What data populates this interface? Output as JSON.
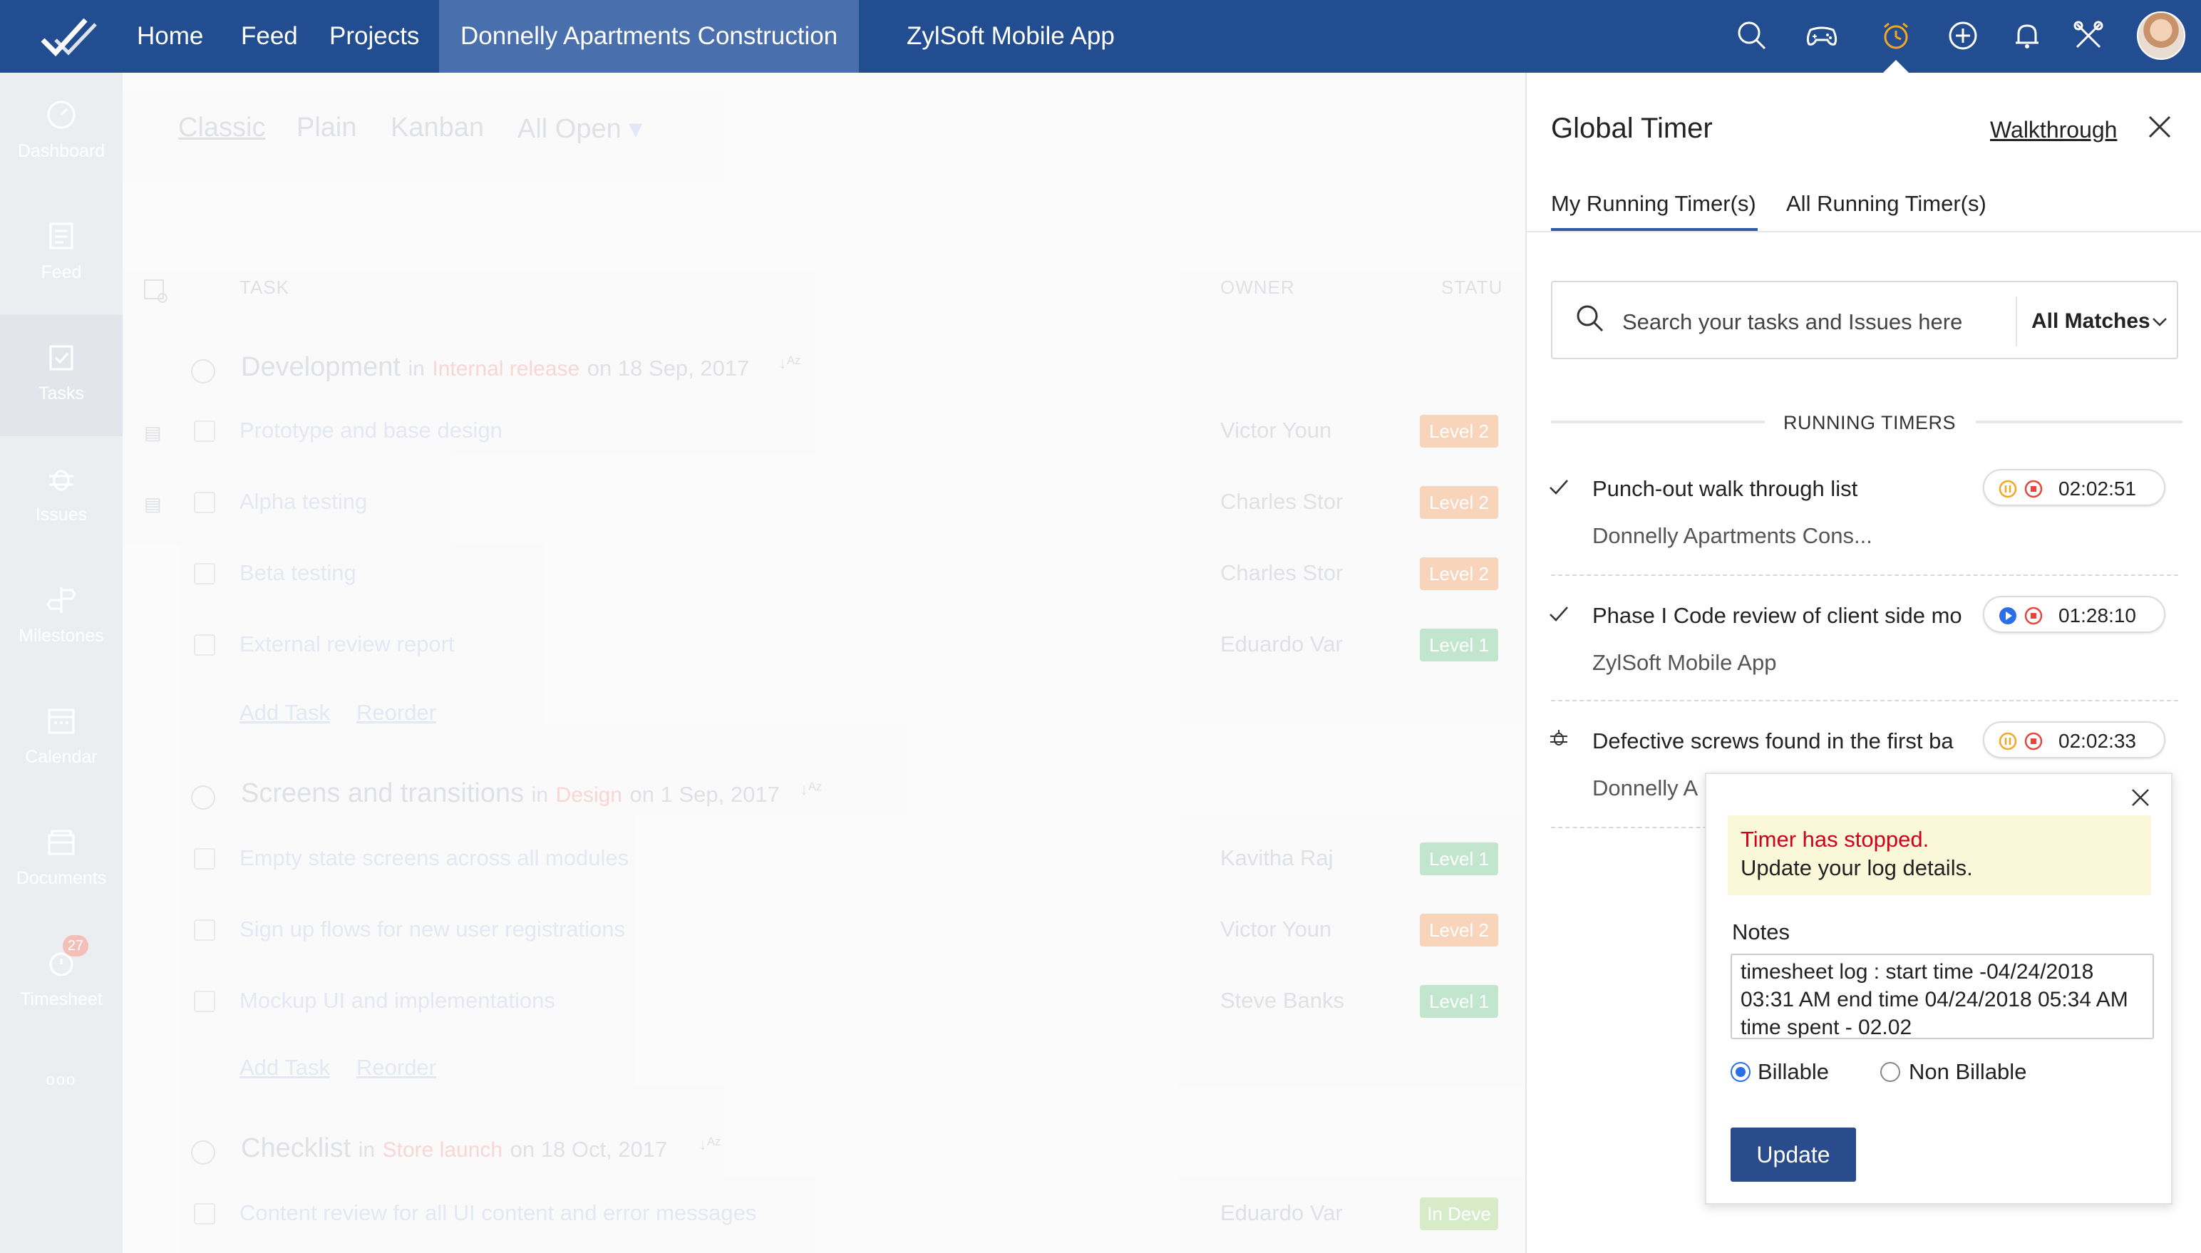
{
  "topbar": {
    "nav": [
      "Home",
      "Feed",
      "Projects",
      "Donnelly Apartments Construction",
      "ZylSoft Mobile App"
    ],
    "icons": [
      "search-icon",
      "gamepad-icon",
      "timer-icon",
      "add-icon",
      "bell-icon",
      "tools-icon"
    ]
  },
  "sidebar": {
    "items": [
      {
        "label": "Dashboard",
        "icon": "dashboard-icon"
      },
      {
        "label": "Feed",
        "icon": "feed-icon"
      },
      {
        "label": "Tasks",
        "icon": "tasks-icon"
      },
      {
        "label": "Issues",
        "icon": "bug-icon"
      },
      {
        "label": "Milestones",
        "icon": "milestone-icon"
      },
      {
        "label": "Calendar",
        "icon": "calendar-icon"
      },
      {
        "label": "Documents",
        "icon": "documents-icon"
      },
      {
        "label": "Timesheet",
        "icon": "timesheet-icon",
        "badge": "27"
      }
    ],
    "more": "ooo"
  },
  "content": {
    "views": [
      "Classic",
      "Plain",
      "Kanban"
    ],
    "filter": "All Open",
    "columns": {
      "task": "TASK",
      "owner": "OWNER",
      "status": "STATU"
    },
    "groups": [
      {
        "name": "Development",
        "in": "in",
        "list": "Internal release",
        "date": "on 18 Sep, 2017",
        "tasks": [
          {
            "name": "Prototype and base design",
            "owner": "Victor Youn",
            "status": "Level 2",
            "color": "#f4b183"
          },
          {
            "name": "Alpha testing",
            "owner": "Charles Stor",
            "status": "Level 2",
            "color": "#f4b183"
          },
          {
            "name": "Beta testing",
            "owner": "Charles Stor",
            "status": "Level 2",
            "color": "#f4b183"
          },
          {
            "name": "External review report",
            "owner": "Eduardo Var",
            "status": "Level 1",
            "color": "#8fd3a5"
          }
        ]
      },
      {
        "name": "Screens and transitions",
        "in": "in",
        "list": "Design",
        "date": "on 1 Sep, 2017",
        "tasks": [
          {
            "name": "Empty state screens across all modules",
            "owner": "Kavitha Raj",
            "status": "Level 1",
            "color": "#8fd3a5"
          },
          {
            "name": "Sign up flows for new user registrations",
            "owner": "Victor Youn",
            "status": "Level 2",
            "color": "#f4b183"
          },
          {
            "name": "Mockup UI and implementations",
            "owner": "Steve Banks",
            "status": "Level 1",
            "color": "#8fd3a5"
          }
        ]
      },
      {
        "name": "Checklist",
        "in": "in",
        "list": "Store launch",
        "date": "on 18 Oct, 2017",
        "tasks": [
          {
            "name": "Content review for all UI content and error messages",
            "owner": "Eduardo Var",
            "status": "In Deve",
            "color": "#b9dc9e"
          }
        ]
      }
    ],
    "add_task": "Add Task",
    "reorder": "Reorder"
  },
  "panel": {
    "title": "Global Timer",
    "walkthrough": "Walkthrough",
    "tabs": [
      "My Running Timer(s)",
      "All Running Timer(s)"
    ],
    "search_placeholder": "Search your tasks and Issues here",
    "filter": "All Matches",
    "section": "RUNNING TIMERS",
    "timers": [
      {
        "type": "task",
        "title": "Punch-out walk through list",
        "project": "Donnelly Apartments Cons...",
        "time": "02:02:51",
        "state": "running"
      },
      {
        "type": "task",
        "title": "Phase I Code review of client side mo",
        "project": "ZylSoft Mobile App",
        "time": "01:28:10",
        "state": "paused"
      },
      {
        "type": "issue",
        "title": "Defective screws found in the first ba",
        "project": "Donnelly Ap",
        "time": "02:02:33",
        "state": "running"
      }
    ]
  },
  "popup": {
    "alert_title": "Timer has stopped.",
    "alert_text": "Update your log details.",
    "notes_label": "Notes",
    "notes_value": "timesheet log : start time -04/24/2018 03:31 AM end time 04/24/2018 05:34 AM time spent - 02.02",
    "billable": "Billable",
    "non_billable": "Non Billable",
    "selected": "Billable",
    "update": "Update"
  },
  "colors": {
    "header": "#234d91",
    "accent": "#2a5aa8",
    "alert_red": "#d0021b",
    "alert_bg": "#fbf7d9",
    "timer_orange": "#f5a623",
    "stop_red": "#e8453c",
    "play_blue": "#2a6ee8"
  }
}
